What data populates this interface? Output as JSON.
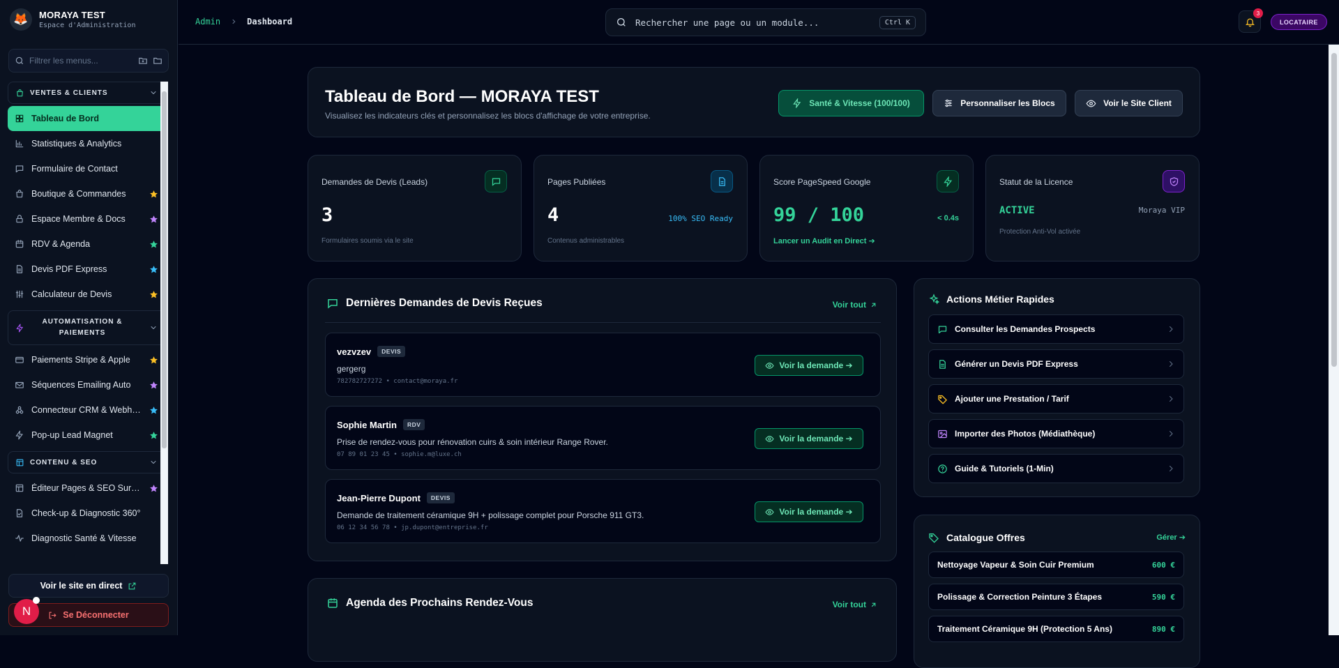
{
  "brand": {
    "title": "MORAYA TEST",
    "subtitle": "Espace d'Administration"
  },
  "sidebar": {
    "filter_placeholder": "Filtrer les menus...",
    "groups": [
      {
        "label": "VENTES & CLIENTS",
        "items": [
          {
            "label": "Tableau de Bord",
            "icon": "grid-icon",
            "active": true
          },
          {
            "label": "Statistiques & Analytics",
            "icon": "bar-chart-icon"
          },
          {
            "label": "Formulaire de Contact",
            "icon": "message-icon"
          },
          {
            "label": "Boutique & Commandes",
            "icon": "bag-icon",
            "star": "#fbbf24"
          },
          {
            "label": "Espace Membre & Docs",
            "icon": "lock-icon",
            "star": "#c084fc"
          },
          {
            "label": "RDV & Agenda",
            "icon": "calendar-icon",
            "star": "#34d399"
          },
          {
            "label": "Devis PDF Express",
            "icon": "document-icon",
            "star": "#38bdf8"
          },
          {
            "label": "Calculateur de Devis",
            "icon": "sliders-icon",
            "star": "#fbbf24"
          }
        ]
      },
      {
        "label": "AUTOMATISATION & PAIEMENTS",
        "items": [
          {
            "label": "Paiements Stripe & Apple",
            "icon": "credit-card-icon",
            "star": "#fbbf24"
          },
          {
            "label": "Séquences Emailing Auto",
            "icon": "mail-icon",
            "star": "#c084fc"
          },
          {
            "label": "Connecteur CRM & Webhooks",
            "icon": "webhook-icon",
            "star": "#38bdf8"
          },
          {
            "label": "Pop-up Lead Magnet",
            "icon": "zap-icon",
            "star": "#34d399"
          }
        ]
      },
      {
        "label": "CONTENU & SEO",
        "items": [
          {
            "label": "Éditeur Pages & SEO Sur-Mesure",
            "icon": "layout-icon",
            "star": "#c084fc"
          },
          {
            "label": "Check-up & Diagnostic 360°",
            "icon": "file-check-icon"
          },
          {
            "label": "Diagnostic Santé & Vitesse",
            "icon": "activity-icon"
          }
        ]
      }
    ],
    "view_live": "Voir le site en direct",
    "logout": "Se Déconnecter",
    "avatar": "N"
  },
  "topbar": {
    "crumb_root": "Admin",
    "crumb_current": "Dashboard",
    "search_placeholder": "Rechercher une page ou un module...",
    "shortcut": "Ctrl K",
    "notifications": "3",
    "role": "LOCATAIRE"
  },
  "hero": {
    "title": "Tableau de Bord — MORAYA TEST",
    "subtitle": "Visualisez les indicateurs clés et personnalisez les blocs d'affichage de votre entreprise.",
    "btn_health": "Santé & Vitesse (100/100)",
    "btn_customize": "Personnaliser les Blocs",
    "btn_client": "Voir le Site Client"
  },
  "stats": [
    {
      "label": "Demandes de Devis (Leads)",
      "value": "3",
      "aside": "",
      "note": "Formulaires soumis via le site"
    },
    {
      "label": "Pages Publiées",
      "value": "4",
      "aside": "100% SEO Ready",
      "note": "Contenus administrables"
    },
    {
      "label": "Score PageSpeed Google",
      "value": "99 / 100",
      "aside": "< 0.4s",
      "link": "Lancer un Audit en Direct ➔"
    },
    {
      "label": "Statut de la Licence",
      "value": "ACTIVE",
      "aside": "Moraya VIP",
      "note": "Protection Anti-Vol activée"
    }
  ],
  "leads": {
    "title": "Dernières Demandes de Devis Reçues",
    "see_all": "Voir tout",
    "view_btn": "Voir la demande ➔",
    "items": [
      {
        "name": "vezvzev",
        "tag": "DEVIS",
        "message": "gergerg",
        "contact": "782782727272 • contact@moraya.fr"
      },
      {
        "name": "Sophie Martin",
        "tag": "RDV",
        "message": "Prise de rendez-vous pour rénovation cuirs & soin intérieur Range Rover.",
        "contact": "07 89 01 23 45 • sophie.m@luxe.ch"
      },
      {
        "name": "Jean-Pierre Dupont",
        "tag": "DEVIS",
        "message": "Demande de traitement céramique 9H + polissage complet pour Porsche 911 GT3.",
        "contact": "06 12 34 56 78 • jp.dupont@entreprise.fr"
      }
    ]
  },
  "agenda": {
    "title": "Agenda des Prochains Rendez-Vous",
    "see_all": "Voir tout"
  },
  "actions": {
    "title": "Actions Métier Rapides",
    "items": [
      {
        "label": "Consulter les Demandes Prospects",
        "icon": "message-icon"
      },
      {
        "label": "Générer un Devis PDF Express",
        "icon": "document-icon"
      },
      {
        "label": "Ajouter une Prestation / Tarif",
        "icon": "tag-icon"
      },
      {
        "label": "Importer des Photos (Médiathèque)",
        "icon": "image-icon"
      },
      {
        "label": "Guide & Tutoriels (1-Min)",
        "icon": "help-circle-icon"
      }
    ]
  },
  "catalog": {
    "title": "Catalogue Offres",
    "manage": "Gérer ➔",
    "items": [
      {
        "name": "Nettoyage Vapeur & Soin Cuir Premium",
        "price": "600 €"
      },
      {
        "name": "Polissage & Correction Peinture 3 Étapes",
        "price": "590 €"
      },
      {
        "name": "Traitement Céramique 9H (Protection 5 Ans)",
        "price": "890 €"
      }
    ]
  },
  "colors": {
    "accent": "#34d399",
    "bg": "#020617",
    "card": "#0b1220",
    "border": "#1e293b",
    "violet": "#a855f7",
    "danger": "#f87171"
  }
}
